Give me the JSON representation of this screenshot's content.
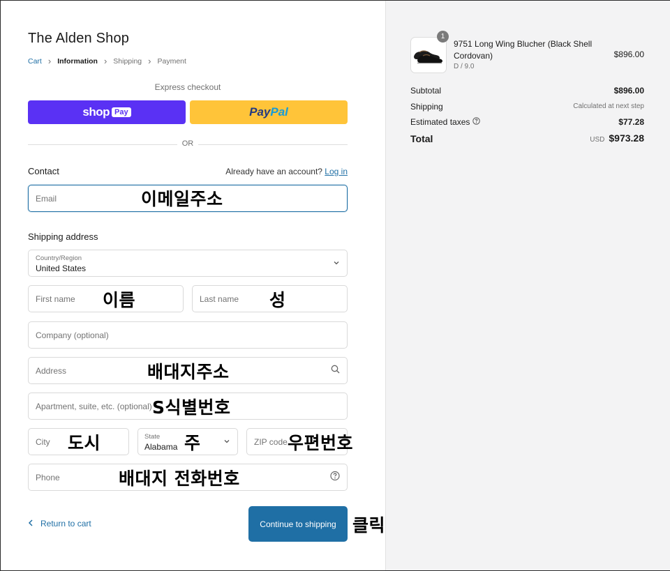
{
  "shop": {
    "title": "The Alden Shop"
  },
  "breadcrumb": {
    "cart": "Cart",
    "information": "Information",
    "shipping": "Shipping",
    "payment": "Payment"
  },
  "express": {
    "label": "Express checkout",
    "shop_pay_word": "shop",
    "shop_pay_pill": "Pay",
    "paypal_part1": "Pay",
    "paypal_part2": "Pal",
    "or_label": "OR"
  },
  "contact": {
    "heading": "Contact",
    "account_prompt": "Already have an account?",
    "login_link": "Log in",
    "email_placeholder": "Email",
    "email_annotation": "이메일주소"
  },
  "shipping": {
    "heading": "Shipping address",
    "country_label": "Country/Region",
    "country_value": "United States",
    "first_name_placeholder": "First name",
    "first_name_annotation": "이름",
    "last_name_placeholder": "Last name",
    "last_name_annotation": "성",
    "company_placeholder": "Company (optional)",
    "address_placeholder": "Address",
    "address_annotation": "배대지주소",
    "apartment_placeholder": "Apartment, suite, etc. (optional)",
    "apartment_annotation": "S식별번호",
    "city_placeholder": "City",
    "city_annotation": "도시",
    "state_label": "State",
    "state_value": "Alabama",
    "state_annotation": "주",
    "zip_placeholder": "ZIP code",
    "zip_annotation": "우편번호",
    "phone_placeholder": "Phone",
    "phone_annotation": "배대지 전화번호"
  },
  "actions": {
    "return_label": "Return to cart",
    "continue_label": "Continue to shipping",
    "continue_annotation": "클릭"
  },
  "summary": {
    "product": {
      "quantity": "1",
      "name": "9751 Long Wing Blucher (Black Shell Cordovan)",
      "variant": "D / 9.0",
      "price": "$896.00"
    },
    "subtotal_label": "Subtotal",
    "subtotal_value": "$896.00",
    "shipping_label": "Shipping",
    "shipping_value": "Calculated at next step",
    "taxes_label": "Estimated taxes",
    "taxes_value": "$77.28",
    "total_label": "Total",
    "currency": "USD",
    "total_value": "$973.28"
  },
  "colors": {
    "accent": "#1f6fa5",
    "shop_pay": "#5a31f4",
    "paypal": "#ffc439",
    "panel_bg": "#f3f3f4"
  }
}
